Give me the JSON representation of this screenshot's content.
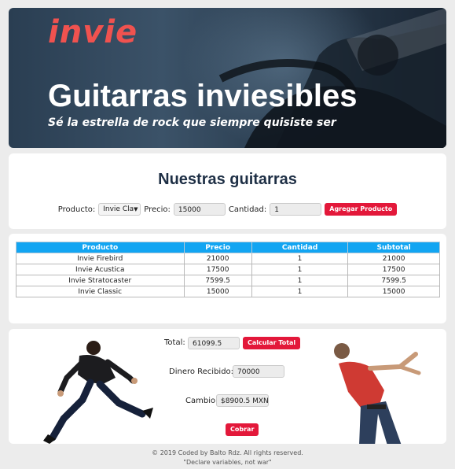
{
  "hero": {
    "logo": "invie",
    "title": "Guitarras inviesibles",
    "subtitle": "Sé la estrella de rock que siempre quisiste ser"
  },
  "form": {
    "section_title": "Nuestras guitarras",
    "product_label": "Producto:",
    "product_selected": "Invie Cla",
    "price_label": "Precio:",
    "price_value": "15000",
    "quantity_label": "Cantidad:",
    "quantity_value": "1",
    "add_button": "Agregar Producto"
  },
  "table": {
    "headers": [
      "Producto",
      "Precio",
      "Cantidad",
      "Subtotal"
    ],
    "rows": [
      [
        "Invie Firebird",
        "21000",
        "1",
        "21000"
      ],
      [
        "Invie Acustica",
        "17500",
        "1",
        "17500"
      ],
      [
        "Invie Stratocaster",
        "7599.5",
        "1",
        "7599.5"
      ],
      [
        "Invie Classic",
        "15000",
        "1",
        "15000"
      ]
    ]
  },
  "totals": {
    "total_label": "Total:",
    "total_value": "61099.5",
    "calc_button": "Calcular Total",
    "received_label": "Dinero Recibido:",
    "received_value": "70000",
    "change_label": "Cambio:",
    "change_value": "$8900.5 MXN",
    "charge_button": "Cobrar"
  },
  "footer": {
    "copyright": "© 2019 Coded by Balto Rdz. All rights reserved.",
    "quote": "\"Declare variables, not war\""
  },
  "colors": {
    "accent_red": "#e3183a",
    "logo_coral": "#f0524f",
    "table_header_blue": "#12a5f2",
    "title_navy": "#1e2f45"
  }
}
